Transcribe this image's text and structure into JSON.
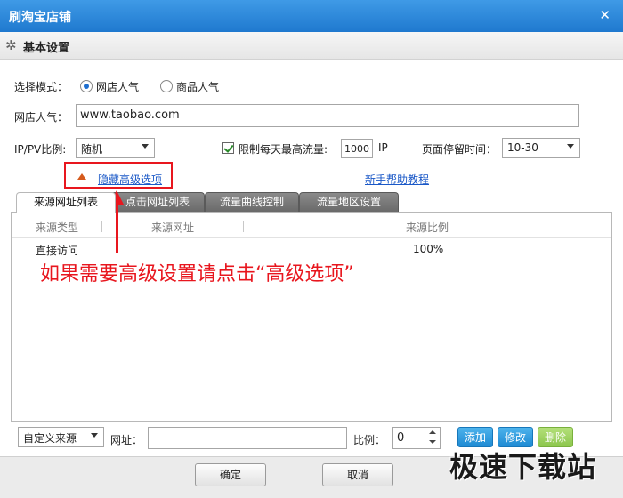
{
  "window": {
    "title": "刷淘宝店铺",
    "close_glyph": "✕"
  },
  "section": {
    "title": "基本设置",
    "icon": "gear-icon"
  },
  "mode": {
    "label": "选择模式：",
    "options": [
      {
        "label": "网店人气",
        "selected": true
      },
      {
        "label": "商品人气",
        "selected": false
      }
    ]
  },
  "shop": {
    "label": "网店人气：",
    "value": "www.taobao.com"
  },
  "ratio": {
    "label": "IP/PV比例:",
    "value": "随机"
  },
  "limit": {
    "label": "限制每天最高流量:",
    "value": "1000",
    "unit": "IP",
    "checked": true
  },
  "stay": {
    "label": "页面停留时间：",
    "value": "10-30"
  },
  "advanced": {
    "label": "隐藏高级选项"
  },
  "help": {
    "label": "新手帮助教程"
  },
  "tabs": [
    {
      "label": "来源网址列表",
      "active": true
    },
    {
      "label": "点击网址列表",
      "active": false
    },
    {
      "label": "流量曲线控制",
      "active": false
    },
    {
      "label": "流量地区设置",
      "active": false
    }
  ],
  "table": {
    "columns": [
      "来源类型",
      "来源网址",
      "来源比例"
    ],
    "rows": [
      {
        "type": "直接访问",
        "url": "",
        "ratio": "100%"
      }
    ]
  },
  "annotation": "如果需要高级设置请点击“高级选项”",
  "source_bar": {
    "source_select": "自定义来源",
    "url_label": "网址：",
    "url_value": "",
    "ratio_label": "比例：",
    "ratio_value": "0",
    "add": "添加",
    "edit": "修改",
    "delete": "删除"
  },
  "footer": {
    "ok": "确定",
    "cancel": "取消"
  },
  "watermark": "极速下载站",
  "colors": {
    "title_bar": "#2b86d8",
    "annotation": "#e8161e",
    "link": "#1a58c7"
  }
}
